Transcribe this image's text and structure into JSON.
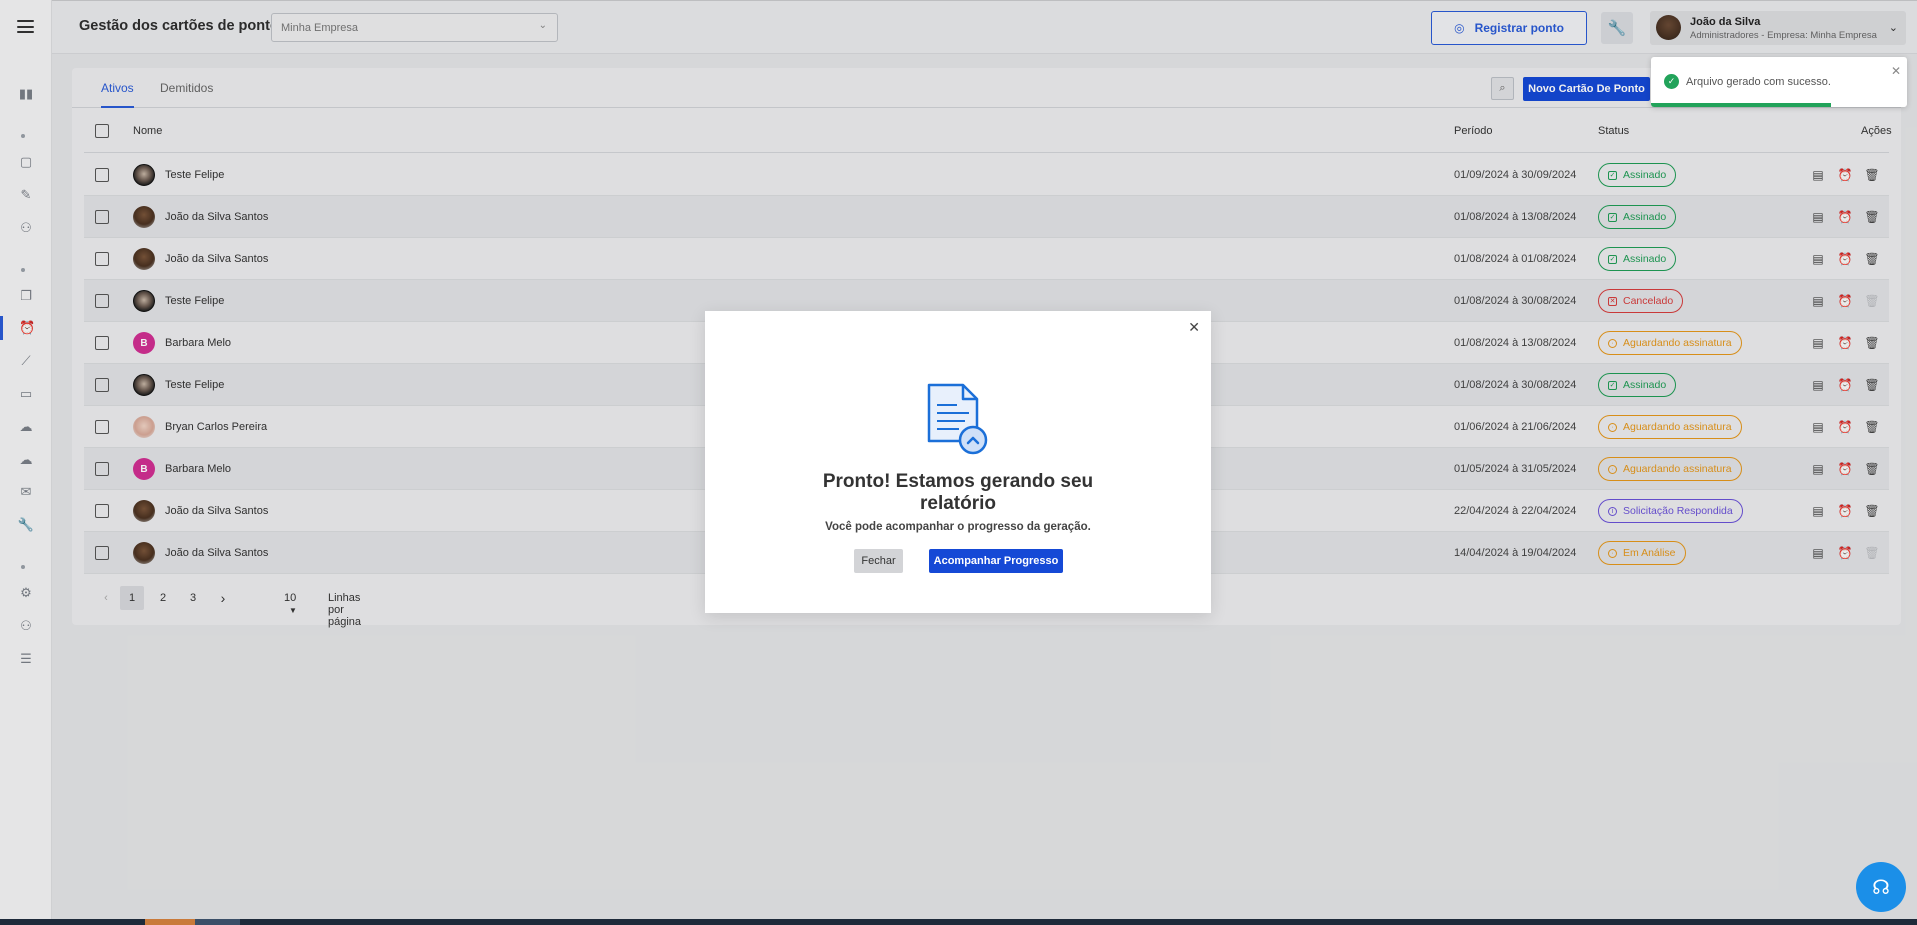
{
  "header": {
    "title": "Gestão dos cartões de ponto",
    "company_select_value": "Minha Empresa",
    "registrar_label": "Registrar ponto",
    "user_name": "João da Silva",
    "user_role": "Administradores - Empresa: Minha Empresa"
  },
  "tabs": [
    {
      "label": "Ativos"
    },
    {
      "label": "Demitidos"
    }
  ],
  "toolbar": {
    "novo_label": "Novo Cartão De Ponto"
  },
  "table": {
    "columns": {
      "nome": "Nome",
      "periodo": "Período",
      "status": "Status",
      "acoes": "Ações"
    },
    "rows": [
      {
        "name": "Teste Felipe",
        "period": "01/09/2024 à 30/09/2024",
        "status": "Assinado"
      },
      {
        "name": "João da Silva Santos",
        "period": "01/08/2024 à 13/08/2024",
        "status": "Assinado"
      },
      {
        "name": "João da Silva Santos",
        "period": "01/08/2024 à 01/08/2024",
        "status": "Assinado"
      },
      {
        "name": "Teste Felipe",
        "period": "01/08/2024 à 30/08/2024",
        "status": "Cancelado"
      },
      {
        "name": "Barbara Melo",
        "initial": "B",
        "period": "01/08/2024 à 13/08/2024",
        "status": "Aguardando assinatura"
      },
      {
        "name": "Teste Felipe",
        "period": "01/08/2024 à 30/08/2024",
        "status": "Assinado"
      },
      {
        "name": "Bryan Carlos Pereira",
        "period": "01/06/2024 à 21/06/2024",
        "status": "Aguardando assinatura"
      },
      {
        "name": "Barbara Melo",
        "initial": "B",
        "period": "01/05/2024 à 31/05/2024",
        "status": "Aguardando assinatura"
      },
      {
        "name": "João da Silva Santos",
        "period": "22/04/2024 à 22/04/2024",
        "status": "Solicitação Respondida"
      },
      {
        "name": "João da Silva Santos",
        "period": "14/04/2024 à 19/04/2024",
        "status": "Em Análise"
      }
    ]
  },
  "pagination": {
    "pages": [
      "1",
      "2",
      "3"
    ],
    "current": "1",
    "rows_per_page": "10",
    "rows_per_page_label": "Linhas por página"
  },
  "toast": {
    "message": "Arquivo gerado com sucesso."
  },
  "modal": {
    "title": "Pronto! Estamos gerando seu relatório",
    "subtitle": "Você pode acompanhar o progresso da geração.",
    "close_label": "Fechar",
    "progress_label": "Acompanhar Progresso"
  },
  "colors": {
    "primary": "#1549d6",
    "success": "#1f9d55",
    "danger": "#d63d3d",
    "warning": "#e5971b",
    "info": "#6b52d8",
    "fab": "#1b8fe8"
  }
}
